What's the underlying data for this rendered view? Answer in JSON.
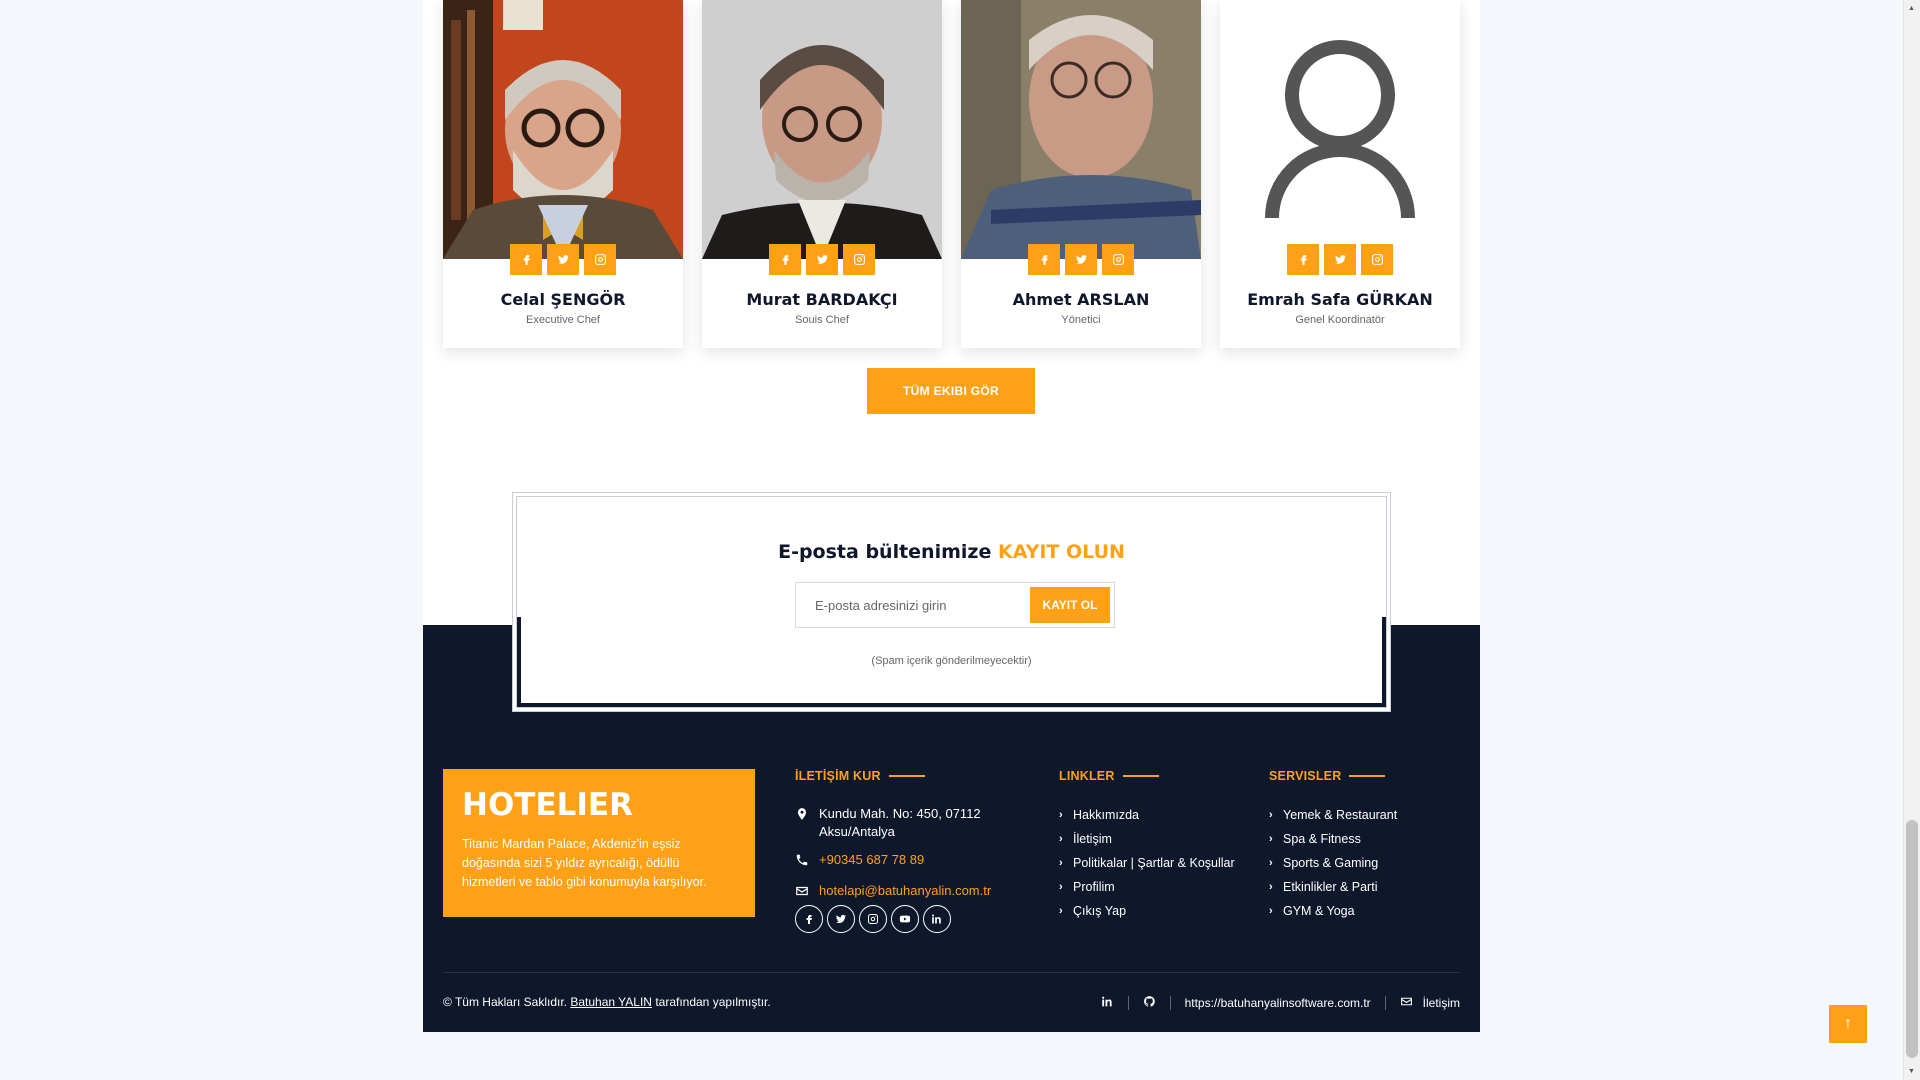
{
  "colors": {
    "accent": "#FEA116",
    "dark": "#0F172B"
  },
  "team": {
    "members": [
      {
        "name": "Celal ŞENGÖR",
        "role": "Executive Chef",
        "photo_icon": "portrait-photo"
      },
      {
        "name": "Murat BARDAKÇI",
        "role": "Souis Chef",
        "photo_icon": "portrait-photo"
      },
      {
        "name": "Ahmet ARSLAN",
        "role": "Yönetici",
        "photo_icon": "portrait-photo"
      },
      {
        "name": "Emrah Safa GÜRKAN",
        "role": "Genel Koordinatör",
        "photo_icon": "user-placeholder-icon"
      }
    ],
    "social_icons": [
      "facebook-icon",
      "twitter-icon",
      "instagram-icon"
    ],
    "all_button": "TÜM EKIBI GÖR"
  },
  "newsletter": {
    "title_main": "E-posta bültenimize",
    "title_accent": "KAYIT OLUN",
    "input_placeholder": "E-posta adresinizi girin",
    "button": "KAYIT OL",
    "note": "(Spam içerik gönderilmeyecektir)"
  },
  "footer": {
    "brand": {
      "title": "HOTELIER",
      "description": "Titanic Mardan Palace, Akdeniz'in eşsiz doğasında sizi 5 yıldız ayrıcalığı, ödüllü hizmetleri ve tablo gibi konumuyla karşılıyor."
    },
    "contact": {
      "title": "İLETİŞİM KUR",
      "address": "Kundu Mah. No: 450, 07112 Aksu/Antalya",
      "phone": "+90345 687 78 89",
      "email": "hotelapi@batuhanyalin.com.tr",
      "social_icons": [
        "facebook-icon",
        "twitter-icon",
        "instagram-icon",
        "youtube-icon",
        "linkedin-icon"
      ]
    },
    "links": {
      "title": "LINKLER",
      "items": [
        "Hakkımızda",
        "İletişim",
        "Politikalar | Şartlar & Koşullar",
        "Profilim",
        "Çıkış Yap"
      ]
    },
    "services": {
      "title": "SERVISLER",
      "items": [
        "Yemek & Restaurant",
        "Spa & Fitness",
        "Sports & Gaming",
        "Etkinlikler & Parti",
        "GYM & Yoga"
      ]
    },
    "bottom": {
      "copyright_prefix": "© Tüm Hakları Saklıdır.",
      "author": "Batuhan YALIN",
      "copyright_suffix": "tarafından yapılmıştır.",
      "website": "https://batuhanyalinsoftware.com.tr",
      "contact_label": "İletişim"
    }
  }
}
